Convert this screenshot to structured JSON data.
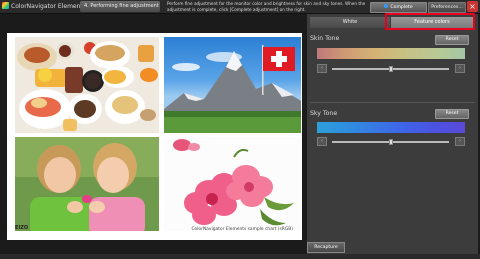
{
  "titlebar": {
    "app_name": "ColorNavigator Elements",
    "step_tab": "4. Performing fine adjustment",
    "instruction": "Perform fine adjustment for the monitor color and brightness for skin and sky tones. When the adjustment is complete, click [Complete adjustment] on the right.",
    "complete_button": "Complete adjustment",
    "preferences_button": "Preferences...",
    "close_icon": "close-icon"
  },
  "chart": {
    "logo_text": "EIZO",
    "caption": "ColorNavigator Elements sample chart (sRGB)",
    "photos": [
      "breakfast-food",
      "matterhorn-mountain-swiss-flag",
      "two-girls",
      "pink-flowers"
    ]
  },
  "right_panel": {
    "tabs": [
      {
        "label": "White",
        "selected": false
      },
      {
        "label": "Feature colors",
        "selected": true
      }
    ],
    "skin_tone": {
      "label": "Skin Tone",
      "reset_label": "Reset",
      "slider_level": 0.5,
      "left_icon": "minus-icon",
      "right_icon": "plus-icon"
    },
    "sky_tone": {
      "label": "Sky Tone",
      "reset_label": "Reset",
      "slider_level": 0.5,
      "left_icon": "minus-icon",
      "right_icon": "plus-icon"
    },
    "recapture_label": "Recapture"
  },
  "colors": {
    "highlight": "#e8001c",
    "background": "#1b1b1b",
    "panel": "#3c3c3c"
  }
}
